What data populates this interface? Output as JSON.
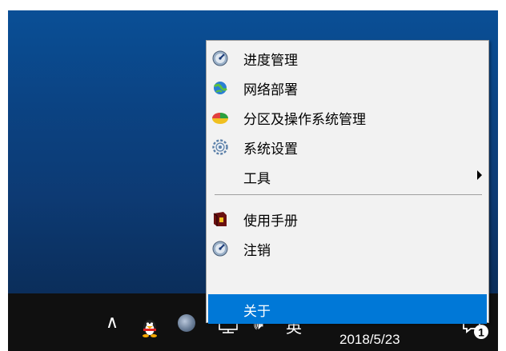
{
  "menu": {
    "items": [
      {
        "label": "进度管理",
        "icon": "progress-gauge-icon"
      },
      {
        "label": "网络部署",
        "icon": "network-deploy-icon"
      },
      {
        "label": "分区及操作系统管理",
        "icon": "partition-os-icon"
      },
      {
        "label": "系统设置",
        "icon": "gear-icon"
      },
      {
        "label": "工具",
        "icon": "none",
        "has_submenu": true
      },
      {
        "label": "使用手册",
        "icon": "manual-book-icon"
      },
      {
        "label": "注销",
        "icon": "logout-gauge-icon"
      },
      {
        "label": "关于",
        "icon": "none",
        "selected": true
      }
    ]
  },
  "taskbar": {
    "chevron": "∧",
    "volume": "🕪",
    "ime": "英",
    "date": "2018/5/23",
    "notification_count": "1"
  },
  "colors": {
    "selected": "#0078d7",
    "menu_bg": "#f2f2f2",
    "taskbar_bg": "#101010"
  }
}
